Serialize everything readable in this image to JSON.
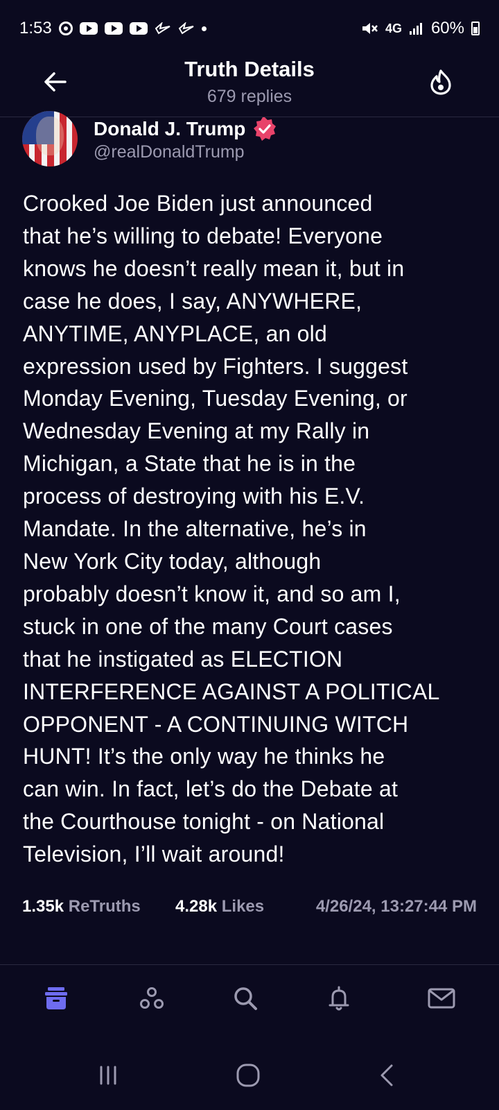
{
  "status_bar": {
    "time": "1:53",
    "network": "4G",
    "battery": "60%",
    "icons": [
      "notification-circle-icon",
      "youtube-icon",
      "youtube-icon",
      "youtube-icon",
      "bird-icon",
      "bird-icon",
      "dot-icon",
      "mute-icon",
      "signal-icon",
      "battery-icon"
    ]
  },
  "header": {
    "title": "Truth Details",
    "subtitle": "679 replies",
    "back_icon": "arrow-left-icon",
    "right_icon": "flame-icon"
  },
  "author": {
    "name": "Donald J. Trump",
    "handle": "@realDonaldTrump",
    "verified_color": "#e8436a"
  },
  "post": {
    "text": "Crooked Joe Biden just announced\nthat he’s willing to debate! Everyone\nknows he doesn’t really mean it, but in\ncase he does, I say, ANYWHERE,\nANYTIME, ANYPLACE, an old\nexpression used by Fighters. I suggest\nMonday Evening, Tuesday Evening, or\nWednesday Evening at my Rally in\nMichigan, a State that he is in the\nprocess of destroying with his E.V.\nMandate. In the alternative, he’s in\nNew York City today, although\nprobably doesn’t know it, and so am I,\nstuck in one of the many Court cases\nthat he instigated as ELECTION\nINTERFERENCE AGAINST A POLITICAL\nOPPONENT - A CONTINUING WITCH\nHUNT! It’s the only way he thinks he\ncan win. In fact, let’s do the Debate at\nthe Courthouse tonight - on National\nTelevision, I’ll wait around!"
  },
  "stats": {
    "retruths_count": "1.35k",
    "retruths_label": "ReTruths",
    "likes_count": "4.28k",
    "likes_label": "Likes",
    "timestamp": "4/26/24, 13:27:44 PM"
  },
  "bottom_nav": {
    "active_color": "#6e6cf0",
    "items": [
      "home-icon",
      "groups-icon",
      "search-icon",
      "bell-icon",
      "mail-icon"
    ]
  },
  "system_nav": [
    "recents-icon",
    "home-circle-icon",
    "back-chevron-icon"
  ]
}
